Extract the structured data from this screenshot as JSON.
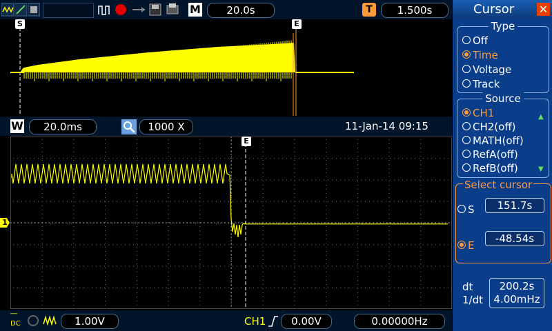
{
  "top_bar": {
    "timebase_label": "M",
    "timebase": "20.0s",
    "trigger_icon_label": "T",
    "trigger_delay": "1.500s"
  },
  "overview": {
    "start_marker": "S",
    "end_marker": "E"
  },
  "window_bar": {
    "window_label": "W",
    "window_timebase": "20.0ms",
    "zoom_factor": "1000 X",
    "datetime": "11-Jan-14 09:15"
  },
  "main_display": {
    "channel_marker": "1",
    "cursor_marker": "E"
  },
  "bottom_bar": {
    "ch1_scale": "1.00V",
    "trigger_source": "CH1",
    "trigger_level": "0.00V",
    "frequency": "0.00000Hz"
  },
  "menu": {
    "title": "Cursor",
    "type_section": "Type",
    "type_options": [
      "Off",
      "Time",
      "Voltage",
      "Track"
    ],
    "type_selected": 1,
    "source_section": "Source",
    "source_options": [
      "CH1",
      "CH2(off)",
      "MATH(off)",
      "RefA(off)",
      "RefB(off)"
    ],
    "source_selected": 0,
    "select_cursor_label": "Select cursor",
    "cursor_s_label": "S",
    "cursor_s_value": "151.7s",
    "cursor_e_label": "E",
    "cursor_e_value": "-48.54s",
    "dt_label": "dt",
    "dt_value": "200.2s",
    "inv_dt_label": "1/dt",
    "inv_dt_value": "4.00mHz"
  },
  "colors": {
    "trace": "#ffff00",
    "cursor_selected": "#ff9a3a",
    "menu_bg": "#0a3d8a",
    "bar_bg": "#00142a"
  }
}
